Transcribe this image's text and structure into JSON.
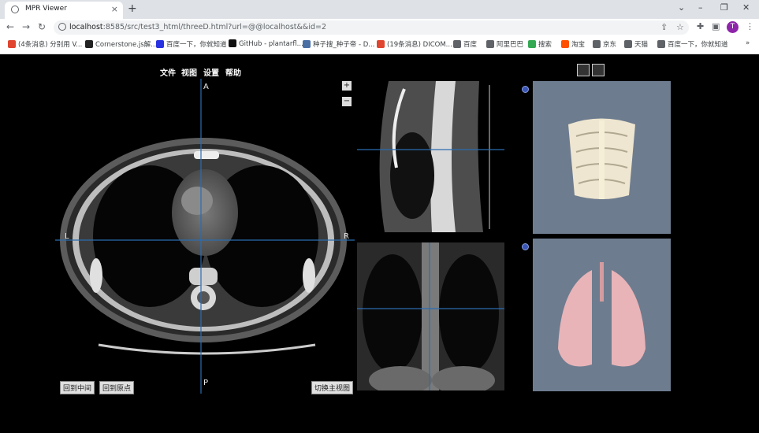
{
  "browser": {
    "tab_title": "MPR Viewer",
    "tab_close": "×",
    "new_tab": "+",
    "url_host": "localhost",
    "url_rest": ":8585/src/test3_html/threeD.html?url=@@localhost&&id=2",
    "profile_initial": "T",
    "minimize": "–",
    "maximize": "❐",
    "close": "✕",
    "back": "←",
    "forward": "→",
    "reload": "↻",
    "bookmarks": [
      {
        "label": "(4条消息) 分别用 V...",
        "color": "#e0452f"
      },
      {
        "label": "Cornerstone.js解...",
        "color": "#222222"
      },
      {
        "label": "百度一下，你就知道",
        "color": "#2932e1"
      },
      {
        "label": "GitHub - plantarfl...",
        "color": "#111111"
      },
      {
        "label": "种子搜_种子帝 - D...",
        "color": "#4a6fa5"
      },
      {
        "label": "(19条消息) DICOM...",
        "color": "#e0452f"
      },
      {
        "label": "百度",
        "color": "#5f6368"
      },
      {
        "label": "阿里巴巴",
        "color": "#5f6368"
      },
      {
        "label": "搜索",
        "color": "#34a853"
      },
      {
        "label": "淘宝",
        "color": "#ff5000"
      },
      {
        "label": "京东",
        "color": "#5f6368"
      },
      {
        "label": "天猫",
        "color": "#5f6368"
      },
      {
        "label": "百度一下，你就知道",
        "color": "#5f6368"
      }
    ],
    "bookmarks_more": "»"
  },
  "viewer": {
    "menu": [
      "文件",
      "视图",
      "设置",
      "帮助"
    ],
    "axial": {
      "top": "A",
      "bottom": "P",
      "left": "L",
      "right": "R"
    },
    "buttons": {
      "back_center": "回到中间",
      "back_origin": "回到原点",
      "switch_main": "切换主视图"
    },
    "zoom_in": "+",
    "zoom_out": "−"
  }
}
